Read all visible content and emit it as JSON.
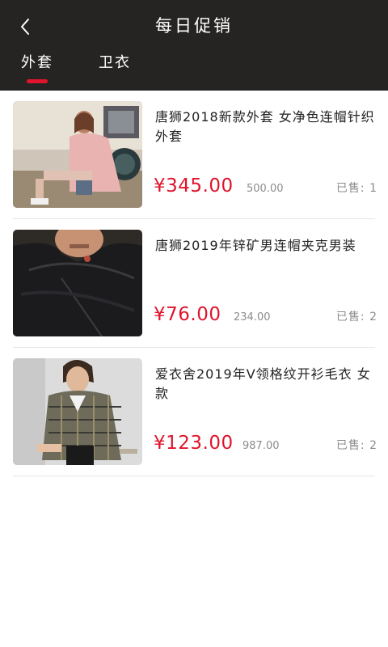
{
  "header": {
    "title": "每日促销",
    "back_icon": "chevron-left-icon",
    "background": "#262423"
  },
  "tabs": [
    {
      "label": "外套",
      "active": true
    },
    {
      "label": "卫衣",
      "active": false
    }
  ],
  "accent_color": "#e0142c",
  "products": [
    {
      "name": "唐狮2018新款外套 女净色连帽针织外套",
      "price": "¥345.00",
      "original_price": "500.00",
      "sold": "已售: 1"
    },
    {
      "name": "唐狮2019年锌矿男连帽夹克男装",
      "price": "¥76.00",
      "original_price": "234.00",
      "sold": "已售: 2"
    },
    {
      "name": "爱衣舍2019年V领格纹开衫毛衣 女款",
      "price": "¥123.00",
      "original_price": "987.00",
      "sold": "已售: 2"
    }
  ]
}
